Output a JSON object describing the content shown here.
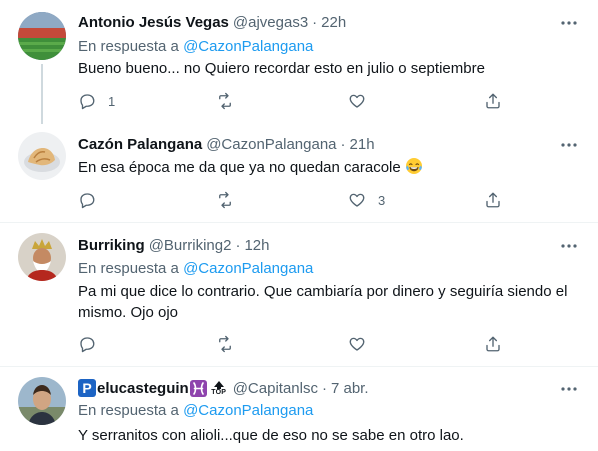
{
  "tweets": [
    {
      "name": "Antonio Jesús Vegas",
      "handle": "@ajvegas3",
      "dot": "·",
      "time": "22h",
      "reply_prefix": "En respuesta a",
      "reply_mention": "@CazonPalangana",
      "text": "Bueno bueno... no Quiero recordar esto en julio o septiembre",
      "reply_count": "1",
      "like_count": ""
    },
    {
      "name": "Cazón Palangana",
      "handle": "@CazonPalangana",
      "dot": "·",
      "time": "21h",
      "text": "En esa época me da que ya no quedan caracole",
      "emoji": "laughing-tears",
      "reply_count": "",
      "like_count": "3"
    },
    {
      "name": "Burriking",
      "handle": "@Burriking2",
      "dot": "·",
      "time": "12h",
      "reply_prefix": "En respuesta a",
      "reply_mention": "@CazonPalangana",
      "text_line1": "Pa mi que dice lo contrario. Que cambiaría por dinero y seguiría siendo el",
      "text_line2": "mismo. Ojo ojo",
      "reply_count": "",
      "like_count": ""
    },
    {
      "name_badge_letter": "P",
      "name": "elucasteguin",
      "name_emojis": [
        "pisces-icon",
        "top-arrow-icon"
      ],
      "top_label": "TOP",
      "handle": "@Capitanlsc",
      "dot": "·",
      "time": "7 abr.",
      "reply_prefix": "En respuesta a",
      "reply_mention": "@CazonPalangana",
      "text": "Y serranitos con alioli...que de eso no se sabe en otro lao."
    }
  ],
  "colors": {
    "text": "#0f1419",
    "secondary": "#536471",
    "link": "#1d9bf0",
    "divider": "#eff3f4",
    "thread_line": "#cfd9de"
  }
}
